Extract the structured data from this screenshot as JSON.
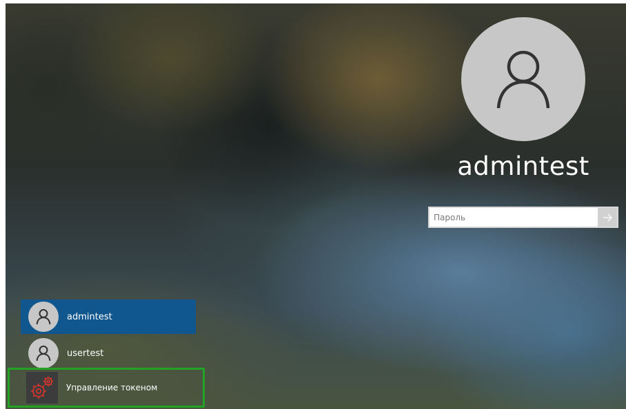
{
  "lock_screen": {
    "selected_user": {
      "name": "admintest",
      "avatar_icon": "user-icon"
    },
    "password": {
      "value": "",
      "placeholder": "Пароль",
      "submit_icon": "arrow-right-icon"
    }
  },
  "user_list": [
    {
      "name": "admintest",
      "selected": true,
      "avatar_icon": "user-icon"
    },
    {
      "name": "usertest",
      "selected": false,
      "avatar_icon": "user-icon"
    }
  ],
  "token_management": {
    "label": "Управление токеном",
    "icon": "gears-icon",
    "highlight_color": "#23a323",
    "icon_color": "#e0342a"
  },
  "colors": {
    "selected_user_bg": "#11578f",
    "avatar_bg": "#c7c7c7",
    "avatar_icon": "#333333"
  }
}
